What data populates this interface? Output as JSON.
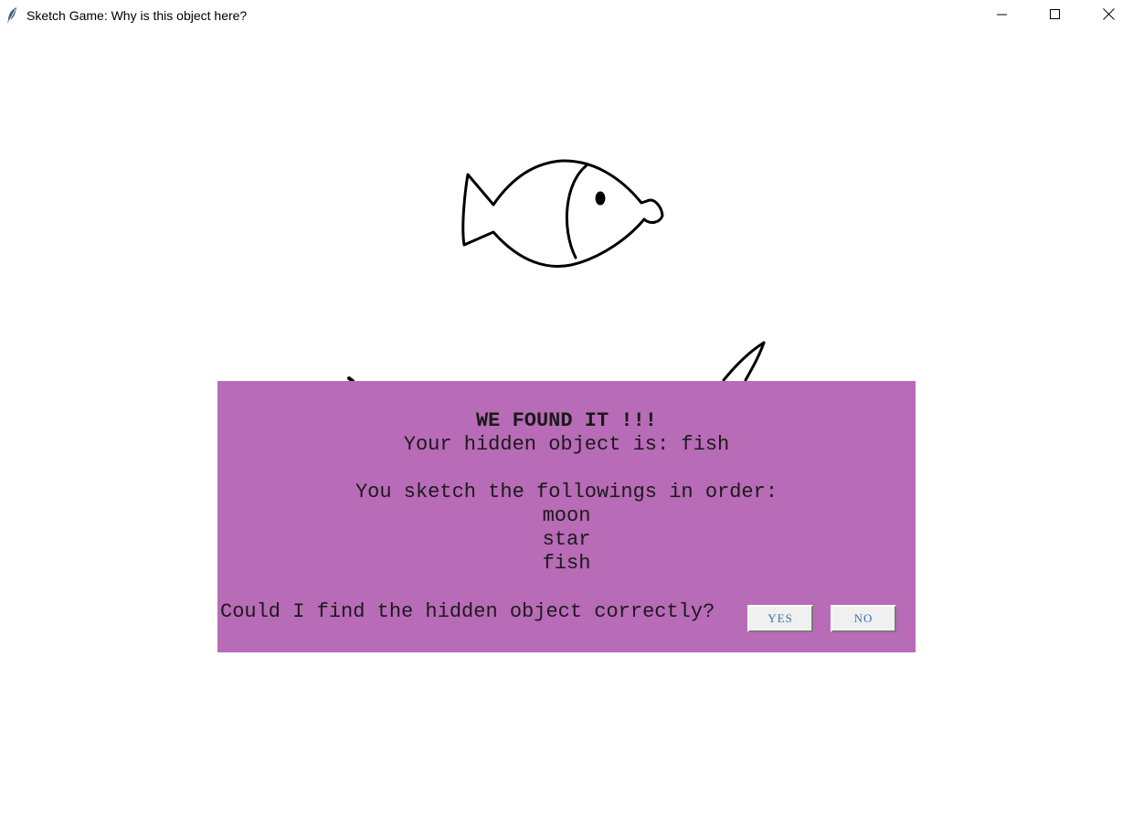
{
  "window": {
    "title": "Sketch Game: Why is this object here?",
    "icon": "feather-icon",
    "controls": [
      "minimize-icon",
      "maximize-icon",
      "close-icon"
    ]
  },
  "dialog": {
    "background_color": "#b86bb6",
    "headline": "WE FOUND IT !!!",
    "result_line": "Your hidden object is: fish",
    "sequence_intro": "You sketch the followings in order:",
    "sequence": [
      "moon",
      "star",
      "fish"
    ],
    "question": "Could I find the hidden object correctly?",
    "yes_label": "YES",
    "no_label": "NO"
  }
}
